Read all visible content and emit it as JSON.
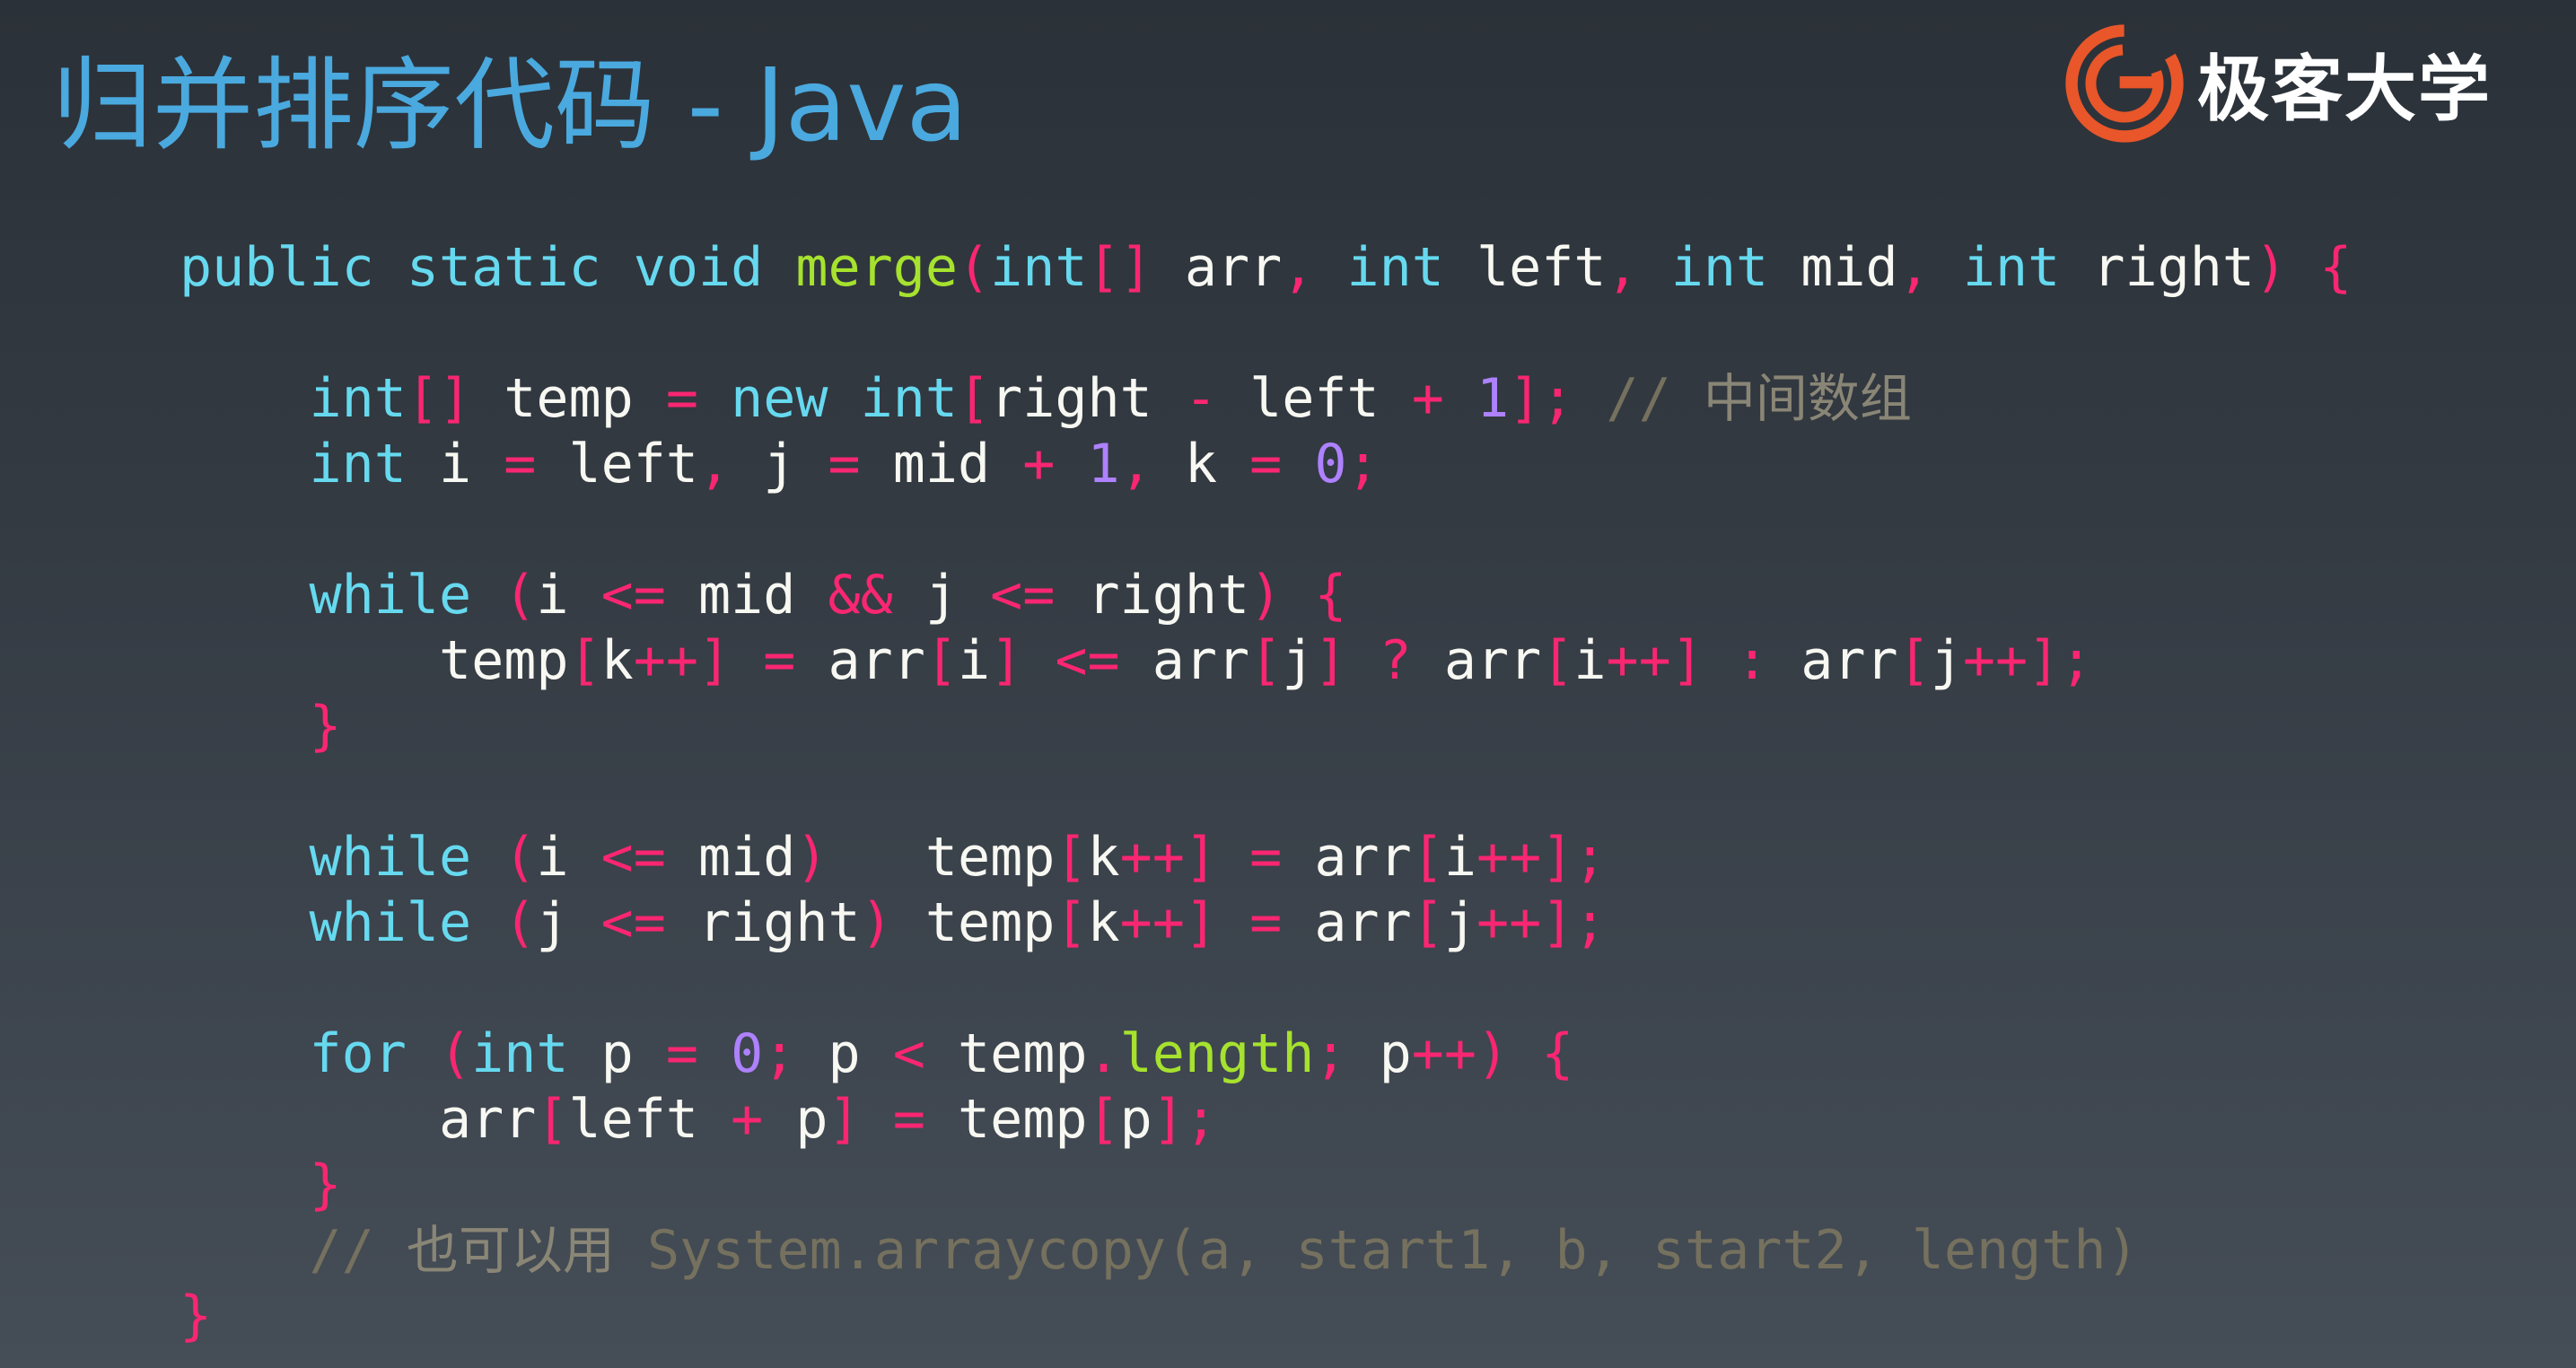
{
  "title": "归并排序代码 - Java",
  "logo": {
    "text": "极客大学",
    "icon": "geekbang-logo-icon",
    "accent": "#e8562a"
  },
  "colors": {
    "title": "#4aa9de",
    "keyword": "#66d9ef",
    "function": "#a6e22e",
    "operator": "#f92672",
    "number": "#ae81ff",
    "comment": "#75715e"
  },
  "code": {
    "l1": {
      "t1": "public",
      "t2": " ",
      "t3": "static",
      "t4": " ",
      "t5": "void",
      "t6": " ",
      "t7": "merge",
      "t8": "(",
      "t9": "int",
      "t10": "[]",
      "t11": " arr",
      "t12": ",",
      "t13": " ",
      "t14": "int",
      "t15": " left",
      "t16": ",",
      "t17": " ",
      "t18": "int",
      "t19": " mid",
      "t20": ",",
      "t21": " ",
      "t22": "int",
      "t23": " right",
      "t24": ")",
      "t25": " {"
    },
    "l2": {},
    "l3": {
      "t0": "    ",
      "t1": "int",
      "t2": "[]",
      "t3": " temp ",
      "t4": "=",
      "t5": " ",
      "t6": "new",
      "t7": " ",
      "t8": "int",
      "t9": "[",
      "t10": "right ",
      "t11": "-",
      "t12": " left ",
      "t13": "+",
      "t14": " ",
      "t15": "1",
      "t16": "];",
      "t17": " ",
      "t18": "// ",
      "t19": "中间数组"
    },
    "l4": {
      "t0": "    ",
      "t1": "int",
      "t2": " i ",
      "t3": "=",
      "t4": " left",
      "t5": ",",
      "t6": " j ",
      "t7": "=",
      "t8": " mid ",
      "t9": "+",
      "t10": " ",
      "t11": "1",
      "t12": ",",
      "t13": " k ",
      "t14": "=",
      "t15": " ",
      "t16": "0",
      "t17": ";"
    },
    "l5": {},
    "l6": {
      "t0": "    ",
      "t1": "while",
      "t2": " ",
      "t3": "(",
      "t4": "i ",
      "t5": "<=",
      "t6": " mid ",
      "t7": "&&",
      "t8": " j ",
      "t9": "<=",
      "t10": " right",
      "t11": ")",
      "t12": " {"
    },
    "l7": {
      "t0": "        ",
      "t1": "temp",
      "t2": "[",
      "t3": "k",
      "t4": "++]",
      "t5": " ",
      "t6": "=",
      "t7": " arr",
      "t8": "[",
      "t9": "i",
      "t10": "]",
      "t11": " ",
      "t12": "<=",
      "t13": " arr",
      "t14": "[",
      "t15": "j",
      "t16": "]",
      "t17": " ",
      "t18": "?",
      "t19": " arr",
      "t20": "[",
      "t21": "i",
      "t22": "++]",
      "t23": " ",
      "t24": ":",
      "t25": " arr",
      "t26": "[",
      "t27": "j",
      "t28": "++];"
    },
    "l8": {
      "t0": "    ",
      "t1": "}"
    },
    "l9": {},
    "l10": {
      "t0": "    ",
      "t1": "while",
      "t2": " ",
      "t3": "(",
      "t4": "i ",
      "t5": "<=",
      "t6": " mid",
      "t7": ")",
      "t8": "   temp",
      "t9": "[",
      "t10": "k",
      "t11": "++]",
      "t12": " ",
      "t13": "=",
      "t14": " arr",
      "t15": "[",
      "t16": "i",
      "t17": "++];"
    },
    "l11": {
      "t0": "    ",
      "t1": "while",
      "t2": " ",
      "t3": "(",
      "t4": "j ",
      "t5": "<=",
      "t6": " right",
      "t7": ")",
      "t8": " temp",
      "t9": "[",
      "t10": "k",
      "t11": "++]",
      "t12": " ",
      "t13": "=",
      "t14": " arr",
      "t15": "[",
      "t16": "j",
      "t17": "++];"
    },
    "l12": {},
    "l13": {
      "t0": "    ",
      "t1": "for",
      "t2": " ",
      "t3": "(",
      "t4": "int",
      "t5": " p ",
      "t6": "=",
      "t7": " ",
      "t8": "0",
      "t9": ";",
      "t10": " p ",
      "t11": "<",
      "t12": " temp",
      "t13": ".",
      "t14": "length",
      "t15": ";",
      "t16": " p",
      "t17": "++)",
      "t18": " {"
    },
    "l14": {
      "t0": "        ",
      "t1": "arr",
      "t2": "[",
      "t3": "left ",
      "t4": "+",
      "t5": " p",
      "t6": "]",
      "t7": " ",
      "t8": "=",
      "t9": " temp",
      "t10": "[",
      "t11": "p",
      "t12": "];"
    },
    "l15": {
      "t0": "    ",
      "t1": "}"
    },
    "l16": {
      "t0": "    ",
      "t1": "// ",
      "t2": "也可以用",
      "t3": " System.arraycopy(a, start1, b, start2, length)"
    },
    "l17": {
      "t1": "}"
    }
  }
}
